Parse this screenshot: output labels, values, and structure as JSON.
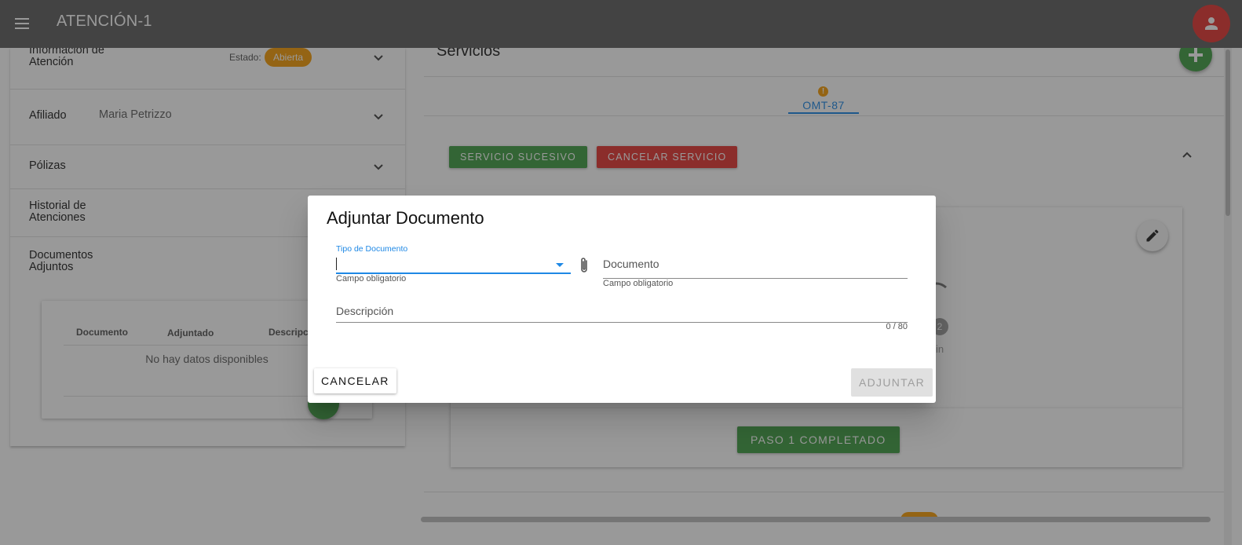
{
  "appbar": {
    "title": "ATENCIÓN-1"
  },
  "left_panel": {
    "info": {
      "title": "Información de Atención",
      "estado_label": "Estado:",
      "estado_value": "Abierta"
    },
    "afiliado": {
      "title": "Afiliado",
      "name": "Maria Petrizzo"
    },
    "polizas": {
      "title": "Pólizas"
    },
    "historial": {
      "title": "Historial de Atenciones"
    },
    "documentos": {
      "title": "Documentos Adjuntos",
      "table_headers": [
        "Documento",
        "Adjuntado",
        "Descripc"
      ],
      "empty_text": "No hay datos disponibles"
    }
  },
  "right_panel": {
    "title": "Servicios",
    "tab": {
      "label": "OMT-87",
      "alert": "!"
    },
    "buttons": {
      "sucesivo": "SERVICIO SUCESIVO",
      "cancelar": "CANCELAR SERVICIO"
    },
    "stepper": {
      "step_number": "2",
      "step_label": "Fin"
    },
    "paso_button": "PASO 1 COMPLETADO"
  },
  "dialog": {
    "title": "Adjuntar Documento",
    "tipo_label": "Tipo de Documento",
    "tipo_value": "",
    "tipo_hint": "Campo obligatorio",
    "documento_placeholder": "Documento",
    "documento_hint": "Campo obligatorio",
    "descripcion_placeholder": "Descripción",
    "counter": "0 / 80",
    "cancel_label": "CANCELAR",
    "submit_label": "ADJUNTAR"
  },
  "colors": {
    "appbar": "#616161",
    "accent_blue": "#1e88e5",
    "green": "#43a047",
    "red": "#e53935",
    "orange": "#f59e0b"
  },
  "icons": [
    "menu-icon",
    "account-icon",
    "chevron-down-icon",
    "chevron-up-icon",
    "add-icon",
    "pencil-icon",
    "paperclip-icon",
    "alert-icon",
    "dropdown-arrow-icon"
  ]
}
